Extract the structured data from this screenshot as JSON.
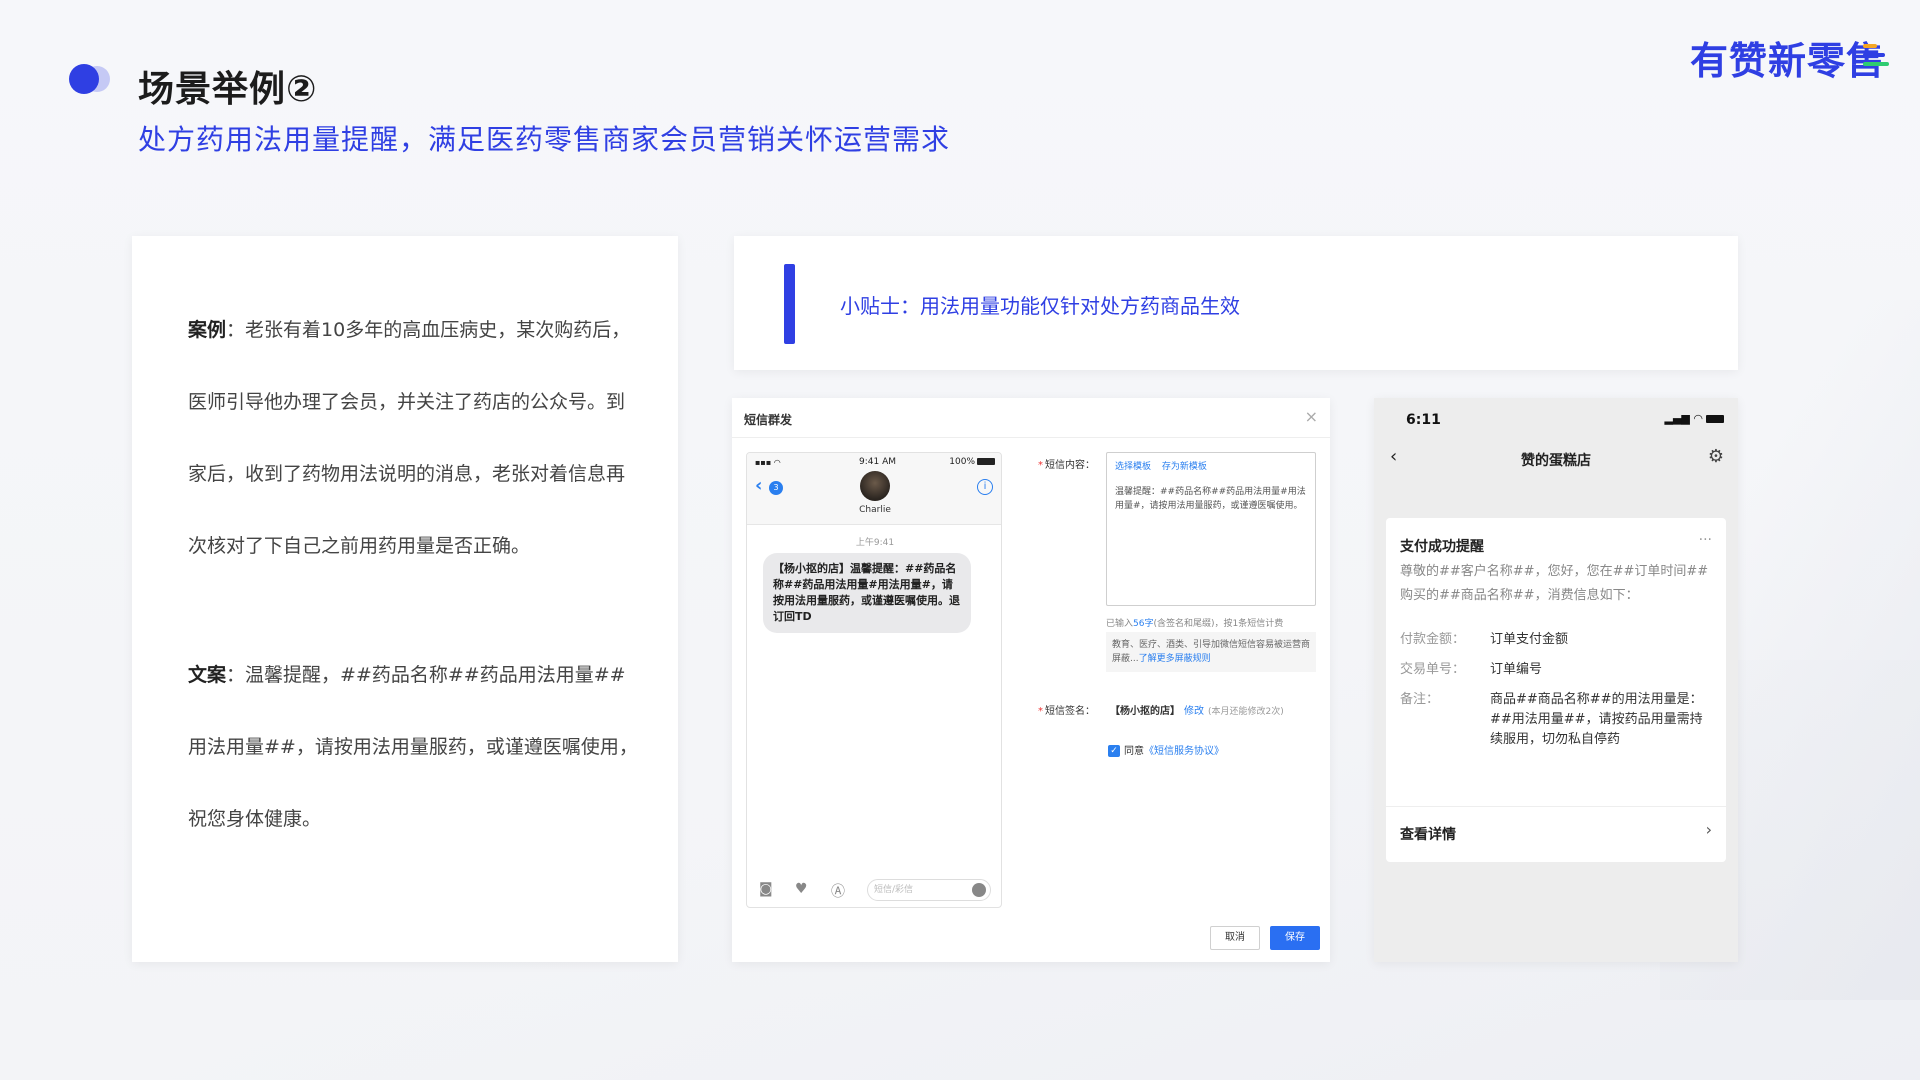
{
  "header": {
    "title": "场景举例②",
    "subtitle": "处方药用法用量提醒，满足医药零售商家会员营销关怀运营需求",
    "brand": "有赞新零售",
    "brand_bar_colors": [
      "#f5a623",
      "#2f3fe3",
      "#2ecc71"
    ]
  },
  "case_card": {
    "case_label": "案例",
    "case_text": "：老张有着10多年的高血压病史，某次购药后，医师引导他办理了会员，并关注了药店的公众号。到家后，收到了药物用法说明的消息，老张对着信息再次核对了下自己之前用药用量是否正确。",
    "copy_label": "文案",
    "copy_text": "：温馨提醒，##药品名称##药品用法用量##用法用量##，请按用法用量服药，或谨遵医嘱使用，祝您身体健康。"
  },
  "tip": {
    "text": "小贴士：用法用量功能仅针对处方药商品生效"
  },
  "sms_panel": {
    "title": "短信群发",
    "close_icon": "×",
    "phone": {
      "signal": "▪▪▪ ◠",
      "time": "9:41 AM",
      "battery": "100%",
      "back_badge": "3",
      "contact_name": "Charlie",
      "info_icon": "i",
      "msg_time": "上午9:41",
      "message": "【杨小抠的店】温馨提醒：##药品名称##药品用法用量#用法用量#，请按用法用量服药，或谨遵医嘱使用。退订回TD",
      "input_placeholder": "短信/彩信"
    },
    "content_label": "短信内容：",
    "template_select": "选择模板",
    "template_save": "存为新模板",
    "content_text": "温馨提醒：##药品名称##药品用法用量#用法用量#，请按用法用量服药，或谨遵医嘱使用。",
    "count_prefix": "已输入",
    "count_value": "56字",
    "count_suffix": "(含签名和尾缀)，按1条短信计费",
    "warn_text": "教育、医疗、酒类、引导加微信短信容易被运营商屏蔽...",
    "warn_link": "了解更多屏蔽规则",
    "signature_label": "短信签名：",
    "signature_value": "【杨小抠的店】",
    "signature_edit": "修改",
    "signature_hint": "(本月还能修改2次)",
    "agree_text": "同意",
    "agree_link": "《短信服务协议》",
    "cancel_label": "取消",
    "save_label": "保存"
  },
  "wechat": {
    "time": "6:11",
    "status": "▂▄▆ ◠",
    "back_icon": "‹",
    "shop_name": "赞的蛋糕店",
    "gear_icon": "⚙",
    "card_title": "支付成功提醒",
    "more_icon": "···",
    "intro": "尊敬的##客户名称##，您好，您在##订单时间##购买的##商品名称##，消费信息如下：",
    "rows": [
      {
        "key": "付款金额：",
        "value": "订单支付金额"
      },
      {
        "key": "交易单号：",
        "value": "订单编号"
      },
      {
        "key": "备注：",
        "value": "商品##商品名称##的用法用量是：##用法用量##，请按药品用量需持续服用，切勿私自停药"
      }
    ],
    "detail_label": "查看详情",
    "arrow_icon": "›"
  }
}
